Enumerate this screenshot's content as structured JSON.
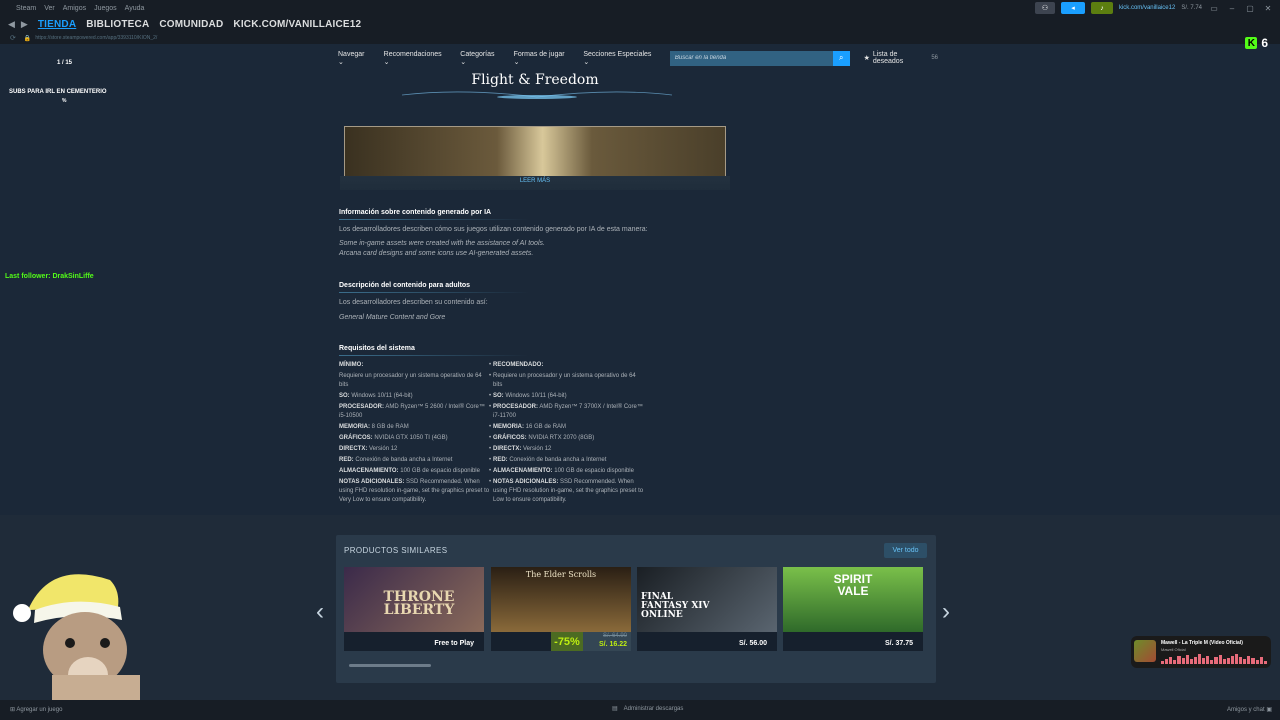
{
  "menubar": {
    "items": [
      "Steam",
      "Ver",
      "Amigos",
      "Juegos",
      "Ayuda"
    ]
  },
  "account": {
    "name": "kick.com/vanillaice12",
    "wallet": "S/. 7.74"
  },
  "nav": {
    "tabs": [
      "TIENDA",
      "BIBLIOTECA",
      "COMUNIDAD",
      "KICK.COM/VANILLAICE12"
    ],
    "url": "https://store.steampowered.com/app/3393110/KION_2/"
  },
  "kick": {
    "count": "6"
  },
  "overlay": {
    "counter": "1 / 15",
    "subs_title": "SUBS PARA IRL EN CEMENTERIO",
    "subs_pct": "%",
    "last_follower": "Last follower: DrakSinLiffe"
  },
  "storenav": {
    "items": [
      "Navegar",
      "Recomendaciones",
      "Categorías",
      "Formas de jugar",
      "Secciones Especiales"
    ],
    "search_placeholder": "Buscar en la tienda",
    "wishlist_label": "Lista de deseados",
    "wishlist_count": "56"
  },
  "banner": {
    "title": "Flight & Freedom",
    "read_more": "LEER MÁS"
  },
  "ai_section": {
    "title": "Información sobre contenido generado por IA",
    "intro": "Los desarrolladores describen cómo sus juegos utilizan contenido generado por IA de esta manera:",
    "line1": "Some in-game assets were created with the assistance of AI tools.",
    "line2": "Arcana card designs and some icons use AI-generated assets."
  },
  "adult_section": {
    "title": "Descripción del contenido para adultos",
    "intro": "Los desarrolladores describen su contenido así:",
    "desc": "General Mature Content and Gore"
  },
  "requirements": {
    "title": "Requisitos del sistema",
    "min": {
      "header": "MÍNIMO:",
      "rows": [
        {
          "k": "",
          "v": "Requiere un procesador y un sistema operativo de 64 bits"
        },
        {
          "k": "SO:",
          "v": "Windows 10/11 (64-bit)"
        },
        {
          "k": "PROCESADOR:",
          "v": "AMD Ryzen™ 5 2600 / Intel® Core™ i5-10500"
        },
        {
          "k": "MEMORIA:",
          "v": "8 GB de RAM"
        },
        {
          "k": "GRÁFICOS:",
          "v": "NVIDIA GTX 1050 TI (4GB)"
        },
        {
          "k": "DIRECTX:",
          "v": "Versión 12"
        },
        {
          "k": "RED:",
          "v": "Conexión de banda ancha a Internet"
        },
        {
          "k": "ALMACENAMIENTO:",
          "v": "100 GB de espacio disponible"
        },
        {
          "k": "NOTAS ADICIONALES:",
          "v": "SSD Recommended. When using FHD resolution in-game, set the graphics preset to Very Low to ensure compatibility."
        }
      ]
    },
    "rec": {
      "header": "RECOMENDADO:",
      "rows": [
        {
          "k": "",
          "v": "Requiere un procesador y un sistema operativo de 64 bits"
        },
        {
          "k": "SO:",
          "v": "Windows 10/11 (64-bit)"
        },
        {
          "k": "PROCESADOR:",
          "v": "AMD Ryzen™ 7 3700X / Intel® Core™ i7-11700"
        },
        {
          "k": "MEMORIA:",
          "v": "16 GB de RAM"
        },
        {
          "k": "GRÁFICOS:",
          "v": "NVIDIA RTX 2070 (8GB)"
        },
        {
          "k": "DIRECTX:",
          "v": "Versión 12"
        },
        {
          "k": "RED:",
          "v": "Conexión de banda ancha a Internet"
        },
        {
          "k": "ALMACENAMIENTO:",
          "v": "100 GB de espacio disponible"
        },
        {
          "k": "NOTAS ADICIONALES:",
          "v": "SSD Recommended. When using FHD resolution in-game, set the graphics preset to Low to ensure compatibility."
        }
      ]
    }
  },
  "similar": {
    "title": "PRODUCTOS SIMILARES",
    "see_all": "Ver todo",
    "cards": [
      {
        "name": "THRONE LIBERTY",
        "price": "Free to Play",
        "colors": [
          "#3b2a4a",
          "#8a6a5a"
        ]
      },
      {
        "name": "The Elder Scrolls",
        "discount": "-75%",
        "original": "S/. 64.90",
        "price": "S/. 16.22",
        "colors": [
          "#2a1f14",
          "#8a6a3a"
        ]
      },
      {
        "name": "FINAL FANTASY XIV ONLINE",
        "price": "S/. 56.00",
        "colors": [
          "#1a1f24",
          "#5a6570"
        ]
      },
      {
        "name": "SPIRIT VALE",
        "price": "S/. 37.75",
        "colors": [
          "#2f6a2a",
          "#7ac04a"
        ]
      }
    ]
  },
  "nowplaying": {
    "title": "Mawell - La Triple M (Video Oficial)",
    "artist": "Mawell Oficial"
  },
  "bottombar": {
    "left": "Agregar un juego",
    "center": "Administrar descargas",
    "right": "Amigos y chat"
  }
}
